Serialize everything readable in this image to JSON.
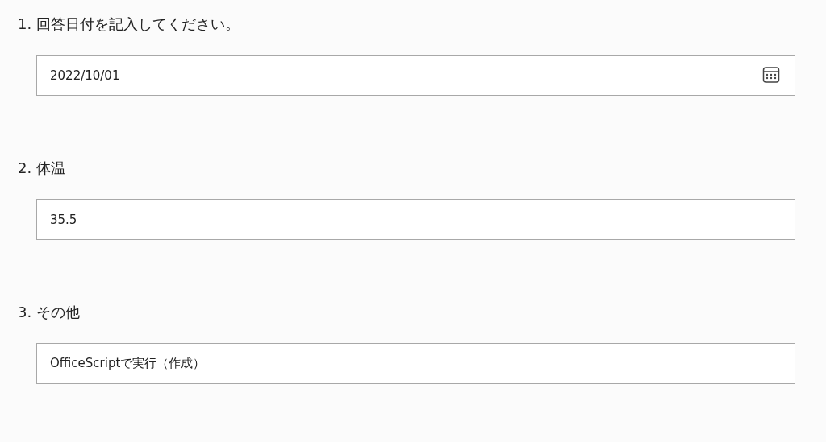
{
  "questions": [
    {
      "number": "1.",
      "label": "回答日付を記入してください。",
      "kind": "date",
      "value": "2022/10/01"
    },
    {
      "number": "2.",
      "label": "体温",
      "kind": "text",
      "value": "35.5"
    },
    {
      "number": "3.",
      "label": "その他",
      "kind": "text",
      "value": "OfficeScriptで実行（作成）"
    }
  ]
}
